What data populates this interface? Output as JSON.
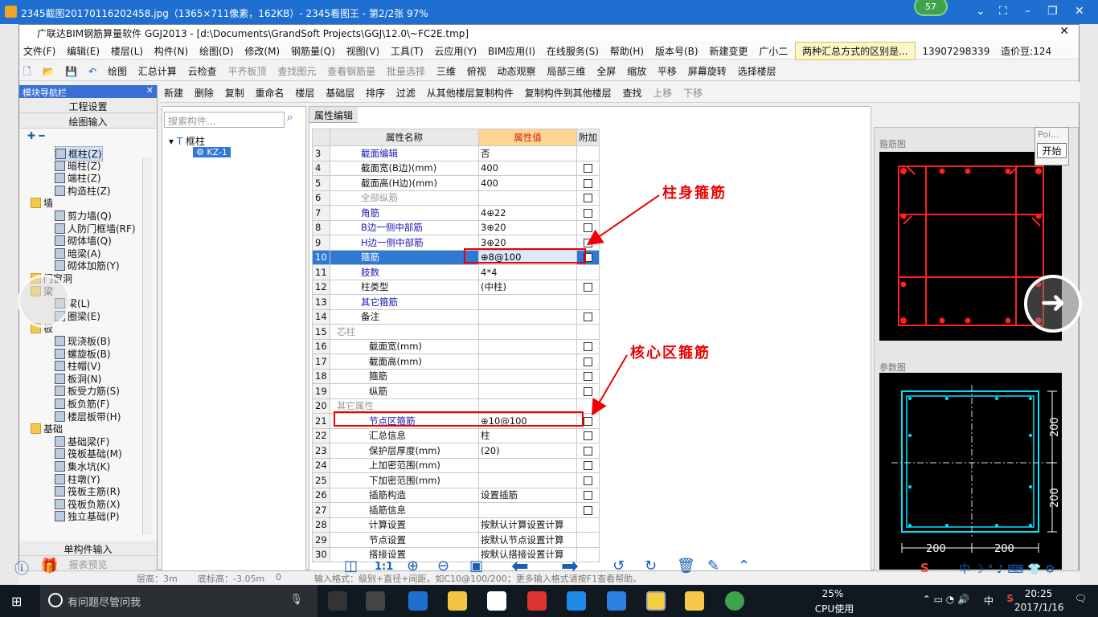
{
  "viewer": {
    "title": "2345截图20170116202458.jpg（1365×711像素，162KB）- 2345看图王 - 第2/2张 97%",
    "badge": "57",
    "controls": [
      "⌄",
      "⛶",
      "–",
      "❐",
      "✕"
    ]
  },
  "app": {
    "title": "广联达BIM钢筋算量软件 GGJ2013 - [d:\\Documents\\GrandSoft Projects\\GGJ\\12.0\\~FC2E.tmp]",
    "menu": [
      "文件(F)",
      "编辑(E)",
      "楼层(L)",
      "构件(N)",
      "绘图(D)",
      "修改(M)",
      "钢筋量(Q)",
      "视图(V)",
      "工具(T)",
      "云应用(Y)",
      "BIM应用(I)",
      "在线服务(S)",
      "帮助(H)",
      "版本号(B)",
      "新建变更",
      "广小二"
    ],
    "notice": "两种汇总方式的区别是...",
    "phone": "13907298339",
    "price": "造价豆:124",
    "toolbar1": [
      "绘图",
      "汇总计算",
      "云检查",
      "平齐板顶",
      "查找图元",
      "查看钢筋量",
      "批量选择",
      "三维",
      "俯视",
      "动态观察",
      "局部三维",
      "全屏",
      "缩放",
      "平移",
      "屏幕旋转",
      "选择楼层"
    ],
    "toolbar2": [
      "新建",
      "删除",
      "复制",
      "重命名",
      "楼层",
      "基础层",
      "排序",
      "过滤",
      "从其他楼层复制构件",
      "复制构件到其他楼层",
      "查找",
      "上移",
      "下移"
    ]
  },
  "nav": {
    "title": "模块导航栏",
    "btn_engineering": "工程设置",
    "btn_draw": "绘图输入",
    "tree": [
      {
        "label": "框柱(Z)",
        "level": 2,
        "sel": true
      },
      {
        "label": "暗柱(Z)",
        "level": 2
      },
      {
        "label": "端柱(Z)",
        "level": 2
      },
      {
        "label": "构造柱(Z)",
        "level": 2
      },
      {
        "label": "墙",
        "level": 1,
        "folder": true
      },
      {
        "label": "剪力墙(Q)",
        "level": 2
      },
      {
        "label": "人防门框墙(RF)",
        "level": 2
      },
      {
        "label": "砌体墙(Q)",
        "level": 2
      },
      {
        "label": "暗梁(A)",
        "level": 2
      },
      {
        "label": "砌体加筋(Y)",
        "level": 2
      },
      {
        "label": "门窗洞",
        "level": 1,
        "folder": true
      },
      {
        "label": "梁",
        "level": 1,
        "folder": true
      },
      {
        "label": "梁(L)",
        "level": 2
      },
      {
        "label": "圈梁(E)",
        "level": 2
      },
      {
        "label": "板",
        "level": 1,
        "folder": true
      },
      {
        "label": "现浇板(B)",
        "level": 2
      },
      {
        "label": "螺旋板(B)",
        "level": 2
      },
      {
        "label": "柱帽(V)",
        "level": 2
      },
      {
        "label": "板洞(N)",
        "level": 2
      },
      {
        "label": "板受力筋(S)",
        "level": 2
      },
      {
        "label": "板负筋(F)",
        "level": 2
      },
      {
        "label": "楼层板带(H)",
        "level": 2
      },
      {
        "label": "基础",
        "level": 1,
        "folder": true
      },
      {
        "label": "基础梁(F)",
        "level": 2
      },
      {
        "label": "筏板基础(M)",
        "level": 2
      },
      {
        "label": "集水坑(K)",
        "level": 2
      },
      {
        "label": "柱墩(Y)",
        "level": 2
      },
      {
        "label": "筏板主筋(R)",
        "level": 2
      },
      {
        "label": "筏板负筋(X)",
        "level": 2
      },
      {
        "label": "独立基础(P)",
        "level": 2
      }
    ],
    "btn_single": "单构件输入",
    "btn_report": "报表预览"
  },
  "components": {
    "search_placeholder": "搜索构件...",
    "root": "框柱",
    "child": "KZ-1"
  },
  "props": {
    "tab": "属性编辑",
    "headers": [
      "属性名称",
      "属性值",
      "附加"
    ],
    "rows": [
      {
        "n": "3",
        "name": "截面编辑",
        "val": "否",
        "style": "blue",
        "cb": false
      },
      {
        "n": "4",
        "name": "截面宽(B边)(mm)",
        "val": "400",
        "style": "",
        "cb": true
      },
      {
        "n": "5",
        "name": "截面高(H边)(mm)",
        "val": "400",
        "style": "",
        "cb": true
      },
      {
        "n": "6",
        "name": "全部纵筋",
        "val": "",
        "style": "gray",
        "cb": true
      },
      {
        "n": "7",
        "name": "角筋",
        "val": "4⊕22",
        "style": "blue",
        "cb": true
      },
      {
        "n": "8",
        "name": "B边一侧中部筋",
        "val": "3⊕20",
        "style": "blue",
        "cb": true
      },
      {
        "n": "9",
        "name": "H边一侧中部筋",
        "val": "3⊕20",
        "style": "blue",
        "cb": true
      },
      {
        "n": "10",
        "name": "箍筋",
        "val": "⊕8@100",
        "style": "sel",
        "cb": true
      },
      {
        "n": "11",
        "name": "肢数",
        "val": "4*4",
        "style": "blue",
        "cb": false
      },
      {
        "n": "12",
        "name": "柱类型",
        "val": "(中柱)",
        "style": "",
        "cb": true
      },
      {
        "n": "13",
        "name": "其它箍筋",
        "val": "",
        "style": "blue",
        "cb": false
      },
      {
        "n": "14",
        "name": "备注",
        "val": "",
        "style": "",
        "cb": true
      },
      {
        "n": "15",
        "name": "芯柱",
        "val": "",
        "style": "grp gray",
        "cb": false
      },
      {
        "n": "16",
        "name": "截面宽(mm)",
        "val": "",
        "style": "sub",
        "cb": true
      },
      {
        "n": "17",
        "name": "截面高(mm)",
        "val": "",
        "style": "sub",
        "cb": true
      },
      {
        "n": "18",
        "name": "箍筋",
        "val": "",
        "style": "sub",
        "cb": true
      },
      {
        "n": "19",
        "name": "纵筋",
        "val": "",
        "style": "sub",
        "cb": true
      },
      {
        "n": "20",
        "name": "其它属性",
        "val": "",
        "style": "grp gray",
        "cb": false
      },
      {
        "n": "21",
        "name": "节点区箍筋",
        "val": "⊕10@100",
        "style": "sub blue",
        "cb": true
      },
      {
        "n": "22",
        "name": "汇总信息",
        "val": "柱",
        "style": "sub",
        "cb": true
      },
      {
        "n": "23",
        "name": "保护层厚度(mm)",
        "val": "(20)",
        "style": "sub",
        "cb": true
      },
      {
        "n": "24",
        "name": "上加密范围(mm)",
        "val": "",
        "style": "sub",
        "cb": true
      },
      {
        "n": "25",
        "name": "下加密范围(mm)",
        "val": "",
        "style": "sub",
        "cb": true
      },
      {
        "n": "26",
        "name": "插筋构造",
        "val": "设置插筋",
        "style": "sub",
        "cb": true
      },
      {
        "n": "27",
        "name": "插筋信息",
        "val": "",
        "style": "sub",
        "cb": true
      },
      {
        "n": "28",
        "name": "计算设置",
        "val": "按默认计算设置计算",
        "style": "sub",
        "cb": false
      },
      {
        "n": "29",
        "name": "节点设置",
        "val": "按默认节点设置计算",
        "style": "sub",
        "cb": false
      },
      {
        "n": "30",
        "name": "搭接设置",
        "val": "按默认搭接设置计算",
        "style": "sub",
        "cb": false
      }
    ]
  },
  "annotations": {
    "a1": "柱身箍筋",
    "a2": "核心区箍筋"
  },
  "preview": {
    "stirrup_label": "箍筋图",
    "param_label": "参数图",
    "dim": "200",
    "poi": "Poi...",
    "start": "开始"
  },
  "statusbar": {
    "floor_height": "层高：3m",
    "base_height": "底标高：-3.05m",
    "zero": "0",
    "hint": "输入格式：级别+直径+间距，如C10@100/200；更多输入格式请按F1查看帮助。"
  },
  "viewer_tools": [
    "1:1"
  ],
  "taskbar": {
    "search": "有问题尽管问我",
    "cpu": "25%",
    "cpu_label": "CPU使用",
    "time": "20:25",
    "date": "2017/1/16",
    "ime": "中"
  },
  "colors": {
    "accent": "#1e6fd1",
    "annotation": "#e00000",
    "rebar_red": "#ff0000",
    "rebar_cyan": "#00e5ff"
  }
}
